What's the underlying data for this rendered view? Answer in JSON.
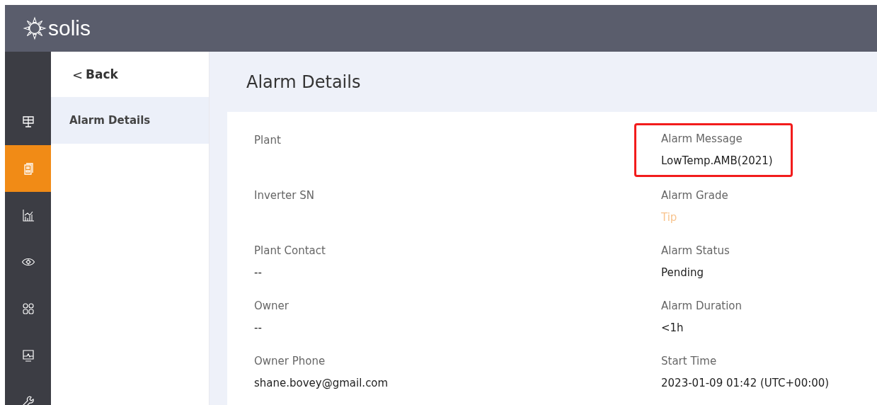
{
  "header": {
    "logo_text": "solis"
  },
  "nav_rail": [
    {
      "selected": false
    },
    {
      "selected": true
    },
    {
      "selected": false
    },
    {
      "selected": false
    },
    {
      "selected": false
    },
    {
      "selected": false
    },
    {
      "selected": false
    }
  ],
  "sub_sidebar": {
    "back": {
      "arrow": "<",
      "label": "Back"
    },
    "items": [
      {
        "label": "Alarm Details",
        "selected": true
      }
    ]
  },
  "page_title": "Alarm Details",
  "left_fields": [
    {
      "label": "Plant"
    },
    {
      "label": "Inverter SN"
    },
    {
      "label": "Plant Contact",
      "value": "--"
    },
    {
      "label": "Owner",
      "value": "--"
    },
    {
      "label": "Owner Phone",
      "value": "shane.bovey@gmail.com"
    }
  ],
  "right_fields": [
    {
      "label": "Alarm Message",
      "value": "LowTemp.AMB(2021)",
      "highlighted": true
    },
    {
      "label": "Alarm Grade",
      "value": "Tip",
      "kind": "grade",
      "highlighted": false
    },
    {
      "label": "Alarm Status",
      "value": "Pending",
      "highlighted": false
    },
    {
      "label": "Alarm Duration",
      "value": "<1h",
      "highlighted": false
    },
    {
      "label": "Start Time",
      "value": "2023-01-09 01:42 (UTC+00:00)",
      "highlighted": false
    }
  ]
}
